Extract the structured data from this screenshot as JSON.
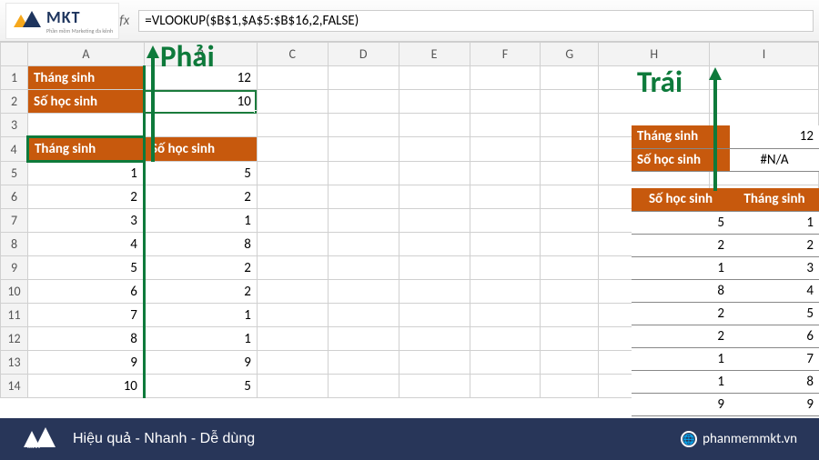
{
  "formula_bar": {
    "fx_label": "fx",
    "formula": "=VLOOKUP($B$1,$A$5:$B$16,2,FALSE)"
  },
  "annotations": {
    "right_label": "Phải",
    "left_label": "Trái"
  },
  "columns": [
    "A",
    "B",
    "C",
    "D",
    "E",
    "F",
    "G",
    "H",
    "I"
  ],
  "rows": [
    "1",
    "2",
    "3",
    "4",
    "5",
    "6",
    "7",
    "8",
    "9",
    "10",
    "11",
    "12",
    "13",
    "14"
  ],
  "left_table": {
    "top": {
      "r1": {
        "label": "Tháng sinh",
        "value": "12"
      },
      "r2": {
        "label": "Số học sinh",
        "value": "10"
      }
    },
    "headers": {
      "colA": "Tháng sinh",
      "colB": "Số học sinh"
    },
    "data": [
      {
        "a": "1",
        "b": "5"
      },
      {
        "a": "2",
        "b": "2"
      },
      {
        "a": "3",
        "b": "1"
      },
      {
        "a": "4",
        "b": "8"
      },
      {
        "a": "5",
        "b": "2"
      },
      {
        "a": "6",
        "b": "2"
      },
      {
        "a": "7",
        "b": "1"
      },
      {
        "a": "8",
        "b": "1"
      },
      {
        "a": "9",
        "b": "9"
      },
      {
        "a": "10",
        "b": "5"
      }
    ]
  },
  "right_block": {
    "top": {
      "r1": {
        "label": "Tháng sinh",
        "value": "12"
      },
      "r2": {
        "label": "Số học sinh",
        "value": "#N/A"
      }
    },
    "headers": {
      "colG": "Số học sinh",
      "colH": "Tháng sinh"
    },
    "data": [
      {
        "g": "5",
        "h": "1"
      },
      {
        "g": "2",
        "h": "2"
      },
      {
        "g": "1",
        "h": "3"
      },
      {
        "g": "8",
        "h": "4"
      },
      {
        "g": "2",
        "h": "5"
      },
      {
        "g": "2",
        "h": "6"
      },
      {
        "g": "1",
        "h": "7"
      },
      {
        "g": "1",
        "h": "8"
      },
      {
        "g": "9",
        "h": "9"
      }
    ]
  },
  "logo": {
    "brand": "MKT",
    "tagline_small": "Phần mềm Marketing đa kênh"
  },
  "banner": {
    "slogan": "Hiệu quả - Nhanh  - Dễ dùng",
    "site": "phanmemmkt.vn"
  }
}
